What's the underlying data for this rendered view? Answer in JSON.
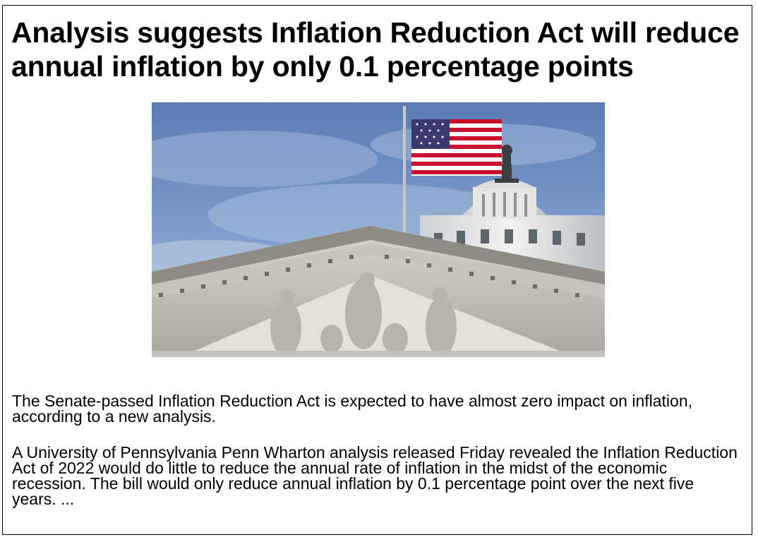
{
  "article": {
    "headline": "Analysis suggests Inflation Reduction Act will reduce annual inflation by only 0.1 percentage points",
    "paragraph_1": "The Senate-passed Inflation Reduction Act is expected to have almost zero impact on inflation, according to a new analysis.",
    "paragraph_2": "A University of Pennsylvania Penn Wharton analysis released Friday revealed the Inflation Reduction Act of 2022 would do little to reduce the annual rate of inflation in the midst of the economic recession. The bill would only reduce annual inflation by 0.1 percentage point over the next five years. ..."
  },
  "photo": {
    "subject": "us-capitol-dome-with-american-flag"
  }
}
